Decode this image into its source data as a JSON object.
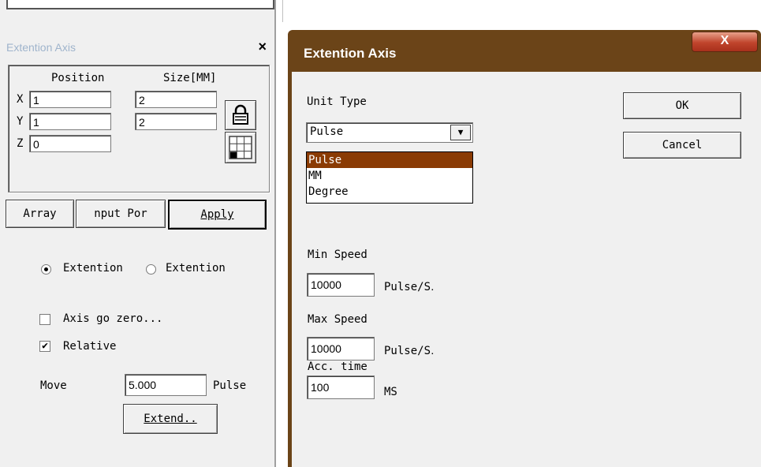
{
  "left_panel": {
    "title": "Extention Axis",
    "close": "×",
    "position_label": "Position",
    "size_label": "Size[MM]",
    "rows": [
      {
        "axis": "X",
        "position": "1",
        "size": "2"
      },
      {
        "axis": "Y",
        "position": "1",
        "size": "2"
      },
      {
        "axis": "Z",
        "position": "0",
        "size": ""
      }
    ],
    "buttons": {
      "array": "Array",
      "input_port": "nput Por",
      "apply": "Apply"
    },
    "radio1": "Extention",
    "radio2": "Extention",
    "axis_go_zero": "Axis go zero...",
    "relative": "Relative",
    "move_label": "Move",
    "move_value": "5.000",
    "move_unit": "Pulse",
    "extend": "Extend.."
  },
  "dialog": {
    "title": "Extention Axis",
    "close": "X",
    "unit_type_label": "Unit Type",
    "unit_type_value": "Pulse",
    "unit_options": [
      "Pulse",
      "MM",
      "Degree"
    ],
    "ok": "OK",
    "cancel": "Cancel",
    "min_speed_label": "Min Speed",
    "min_speed_value": "10000",
    "min_speed_unit": "Pulse/S․",
    "max_speed_label": "Max Speed",
    "max_speed_value": "10000",
    "max_speed_unit": "Pulse/S․",
    "acc_label": "Acc. time",
    "acc_value": "100",
    "acc_unit": "MS"
  }
}
